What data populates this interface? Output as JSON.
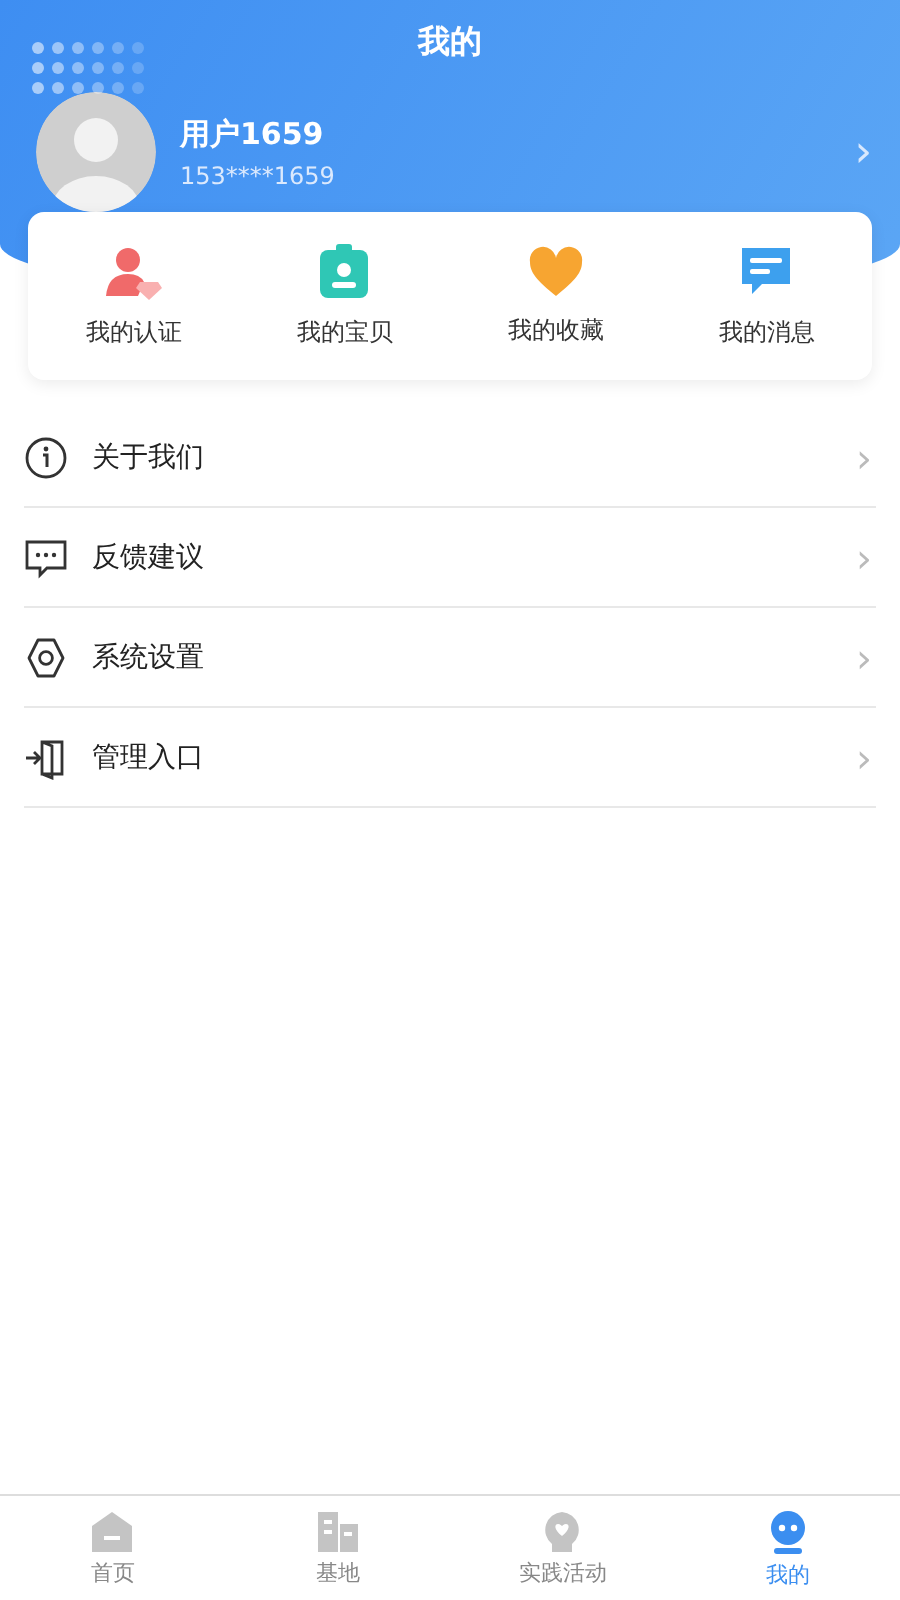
{
  "header": {
    "title": "我的"
  },
  "profile": {
    "name": "用户1659",
    "phone": "153****1659",
    "chevron": "›"
  },
  "shortcuts": [
    {
      "kind": "badge",
      "label": "我的认证"
    },
    {
      "kind": "card",
      "label": "我的宝贝"
    },
    {
      "kind": "heart",
      "label": "我的收藏"
    },
    {
      "kind": "message",
      "label": "我的消息"
    }
  ],
  "menu": [
    {
      "kind": "info",
      "label": "关于我们",
      "chevron": "›"
    },
    {
      "kind": "chat",
      "label": "反馈建议",
      "chevron": "›"
    },
    {
      "kind": "gear",
      "label": "系统设置",
      "chevron": "›"
    },
    {
      "kind": "door",
      "label": "管理入口",
      "chevron": "›"
    }
  ],
  "tabs": [
    {
      "kind": "home",
      "label": "首页",
      "selected": false
    },
    {
      "kind": "building",
      "label": "基地",
      "selected": false
    },
    {
      "kind": "bulb",
      "label": "实践活动",
      "selected": false
    },
    {
      "kind": "robot",
      "label": "我的",
      "selected": true
    }
  ]
}
